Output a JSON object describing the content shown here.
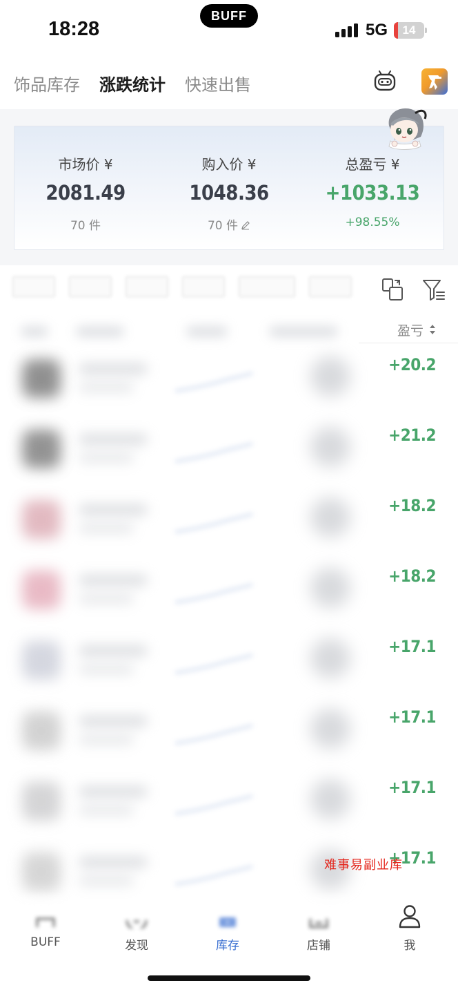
{
  "status_bar": {
    "time": "18:28",
    "island_label": "BUFF",
    "network": "5G",
    "battery": "14",
    "battery_level": 0.14
  },
  "tabs": [
    {
      "label": "饰品库存",
      "active": false
    },
    {
      "label": "涨跌统计",
      "active": true
    },
    {
      "label": "快速出售",
      "active": false
    }
  ],
  "summary": {
    "market_label": "市场价 ¥",
    "market_value": "2081.49",
    "market_count": "70 件",
    "buy_label": "购入价 ¥",
    "buy_value": "1048.36",
    "buy_count": "70 件",
    "profit_label": "总盈亏 ¥",
    "profit_value": "+1033.13",
    "profit_pct": "+98.55%"
  },
  "list": {
    "sort_label": "盈亏",
    "rows": [
      {
        "pl": "+20.2",
        "thumb_color": "#6c6c6c"
      },
      {
        "pl": "+21.2",
        "thumb_color": "#707070"
      },
      {
        "pl": "+18.2",
        "thumb_color": "#d9a3ad"
      },
      {
        "pl": "+18.2",
        "thumb_color": "#e2a4b3"
      },
      {
        "pl": "+17.1",
        "thumb_color": "#c7cad6"
      },
      {
        "pl": "+17.1",
        "thumb_color": "#c4c4c4"
      },
      {
        "pl": "+17.1",
        "thumb_color": "#c7c7c9"
      },
      {
        "pl": "+17.1",
        "thumb_color": "#c9c9c9"
      }
    ]
  },
  "watermark": "难事易副业库",
  "bottom_nav": [
    {
      "label": "BUFF",
      "icon": "home-icon",
      "active": false
    },
    {
      "label": "发现",
      "icon": "discover-icon",
      "active": false
    },
    {
      "label": "库存",
      "icon": "inventory-icon",
      "active": true
    },
    {
      "label": "店铺",
      "icon": "shop-icon",
      "active": false
    },
    {
      "label": "我",
      "icon": "profile-icon",
      "active": false
    }
  ],
  "colors": {
    "profit_green": "#48a56a",
    "accent_blue": "#3a6fd1",
    "watermark_red": "#e4251b"
  }
}
